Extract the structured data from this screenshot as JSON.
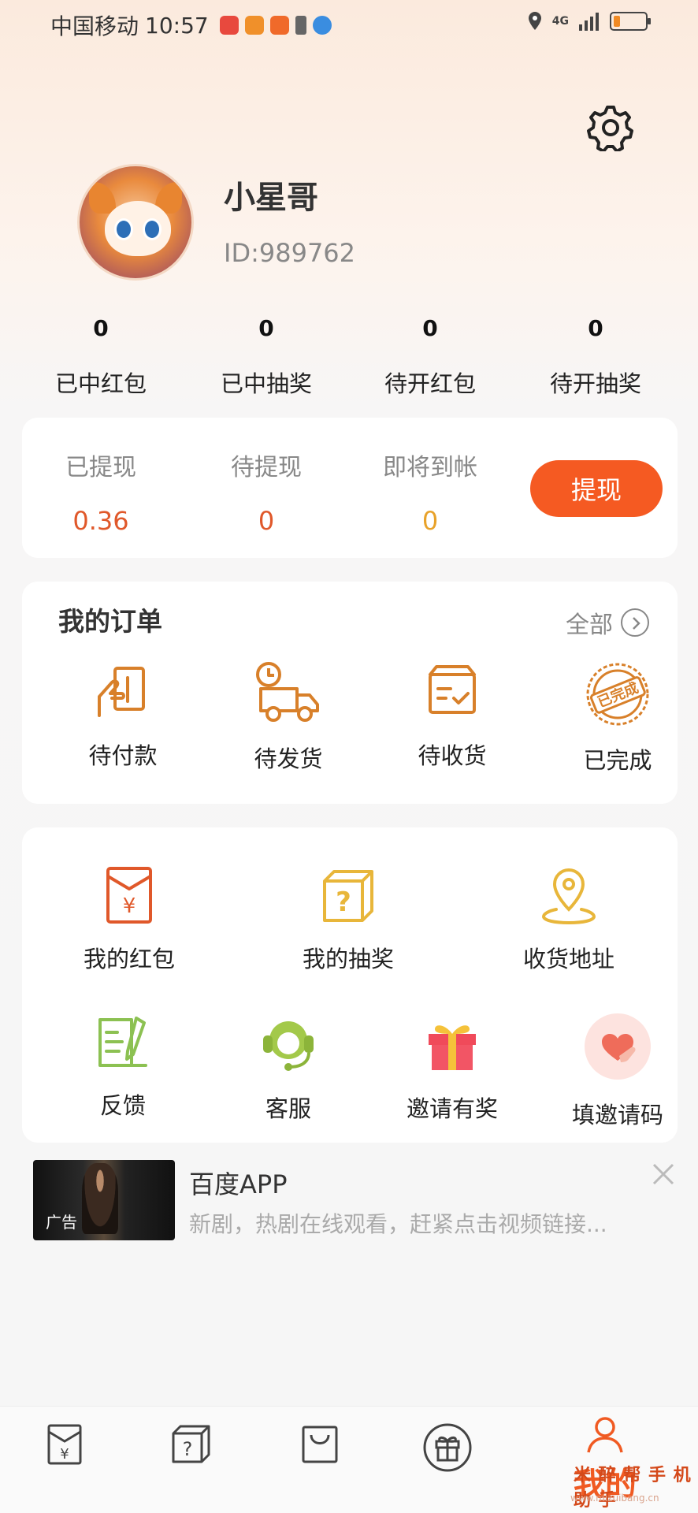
{
  "status_bar": {
    "carrier": "中国移动",
    "time": "10:57",
    "network": "4G",
    "battery_percent": 20
  },
  "profile": {
    "username": "小星哥",
    "user_id": "ID:989762"
  },
  "stats": [
    {
      "value": "0",
      "label": "已中红包"
    },
    {
      "value": "0",
      "label": "已中抽奖"
    },
    {
      "value": "0",
      "label": "待开红包"
    },
    {
      "value": "0",
      "label": "待开抽奖"
    }
  ],
  "withdraw": {
    "items": [
      {
        "label": "已提现",
        "value": "0.36",
        "color": "#e0582a"
      },
      {
        "label": "待提现",
        "value": "0",
        "color": "#e0582a"
      },
      {
        "label": "即将到帐",
        "value": "0",
        "color": "#e8a22a"
      }
    ],
    "button_label": "提现"
  },
  "orders": {
    "title": "我的订单",
    "all_label": "全部",
    "items": [
      {
        "label": "待付款",
        "icon": "payment-icon"
      },
      {
        "label": "待发货",
        "icon": "delivery-truck-icon"
      },
      {
        "label": "待收货",
        "icon": "package-box-icon"
      },
      {
        "label": "已完成",
        "icon": "completed-stamp-icon"
      }
    ]
  },
  "tools": {
    "row1": [
      {
        "label": "我的红包",
        "icon": "red-envelope-icon"
      },
      {
        "label": "我的抽奖",
        "icon": "mystery-box-icon"
      },
      {
        "label": "收货地址",
        "icon": "location-pin-icon"
      }
    ],
    "row2": [
      {
        "label": "反馈",
        "icon": "feedback-icon"
      },
      {
        "label": "客服",
        "icon": "customer-service-icon"
      },
      {
        "label": "邀请有奖",
        "icon": "gift-icon"
      },
      {
        "label": "填邀请码",
        "icon": "heart-hand-icon"
      }
    ]
  },
  "ad": {
    "title": "百度APP",
    "description": "新剧，热剧在线观看，赶紧点击视频链接...",
    "tag": "广告"
  },
  "tabbar": {
    "tabs": [
      {
        "icon": "red-envelope-icon"
      },
      {
        "icon": "mystery-box-icon"
      },
      {
        "icon": "shopping-bag-icon"
      },
      {
        "icon": "gift-icon"
      },
      {
        "icon": "person-icon",
        "label": "我的"
      }
    ]
  },
  "colors": {
    "accent": "#f55a22",
    "orange_icon": "#d8802a",
    "gold_icon": "#e8b63a"
  }
}
